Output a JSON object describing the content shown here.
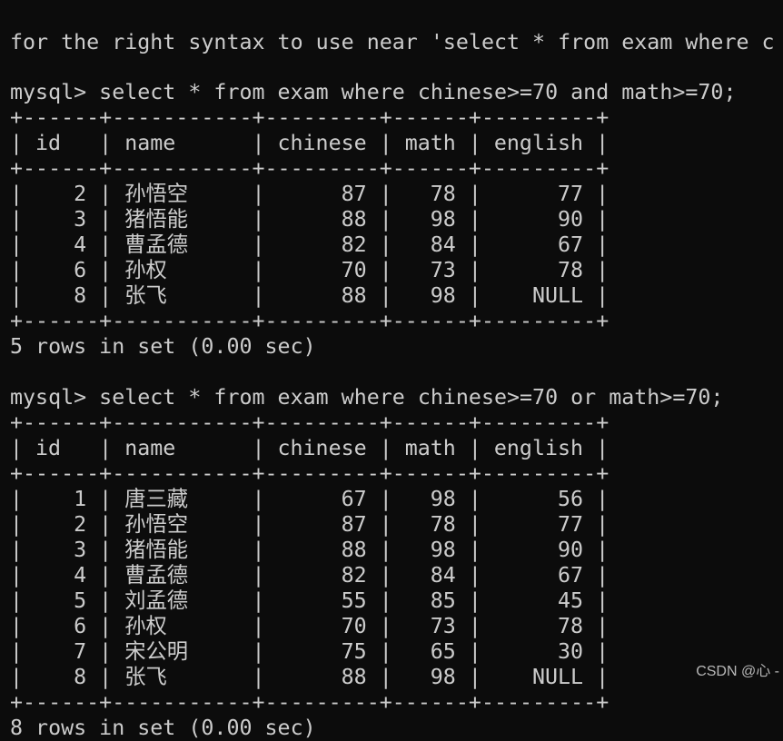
{
  "terminal": {
    "previous_output_partial": "for the right syntax to use near 'select * from exam where c",
    "queries": [
      {
        "command": "mysql> select * from exam where chinese>=70 and math>=70;",
        "columns": [
          "id",
          "name",
          "chinese",
          "math",
          "english"
        ],
        "rows": [
          [
            "2",
            "孙悟空",
            "87",
            "78",
            "77"
          ],
          [
            "3",
            "猪悟能",
            "88",
            "98",
            "90"
          ],
          [
            "4",
            "曹孟德",
            "82",
            "84",
            "67"
          ],
          [
            "6",
            "孙权",
            "70",
            "73",
            "78"
          ],
          [
            "8",
            "张飞",
            "88",
            "98",
            "NULL"
          ]
        ],
        "summary": "5 rows in set (0.00 sec)"
      },
      {
        "command": "mysql> select * from exam where chinese>=70 or math>=70;",
        "columns": [
          "id",
          "name",
          "chinese",
          "math",
          "english"
        ],
        "rows": [
          [
            "1",
            "唐三藏",
            "67",
            "98",
            "56"
          ],
          [
            "2",
            "孙悟空",
            "87",
            "78",
            "77"
          ],
          [
            "3",
            "猪悟能",
            "88",
            "98",
            "90"
          ],
          [
            "4",
            "曹孟德",
            "82",
            "84",
            "67"
          ],
          [
            "5",
            "刘孟德",
            "55",
            "85",
            "45"
          ],
          [
            "6",
            "孙权",
            "70",
            "73",
            "78"
          ],
          [
            "7",
            "宋公明",
            "75",
            "65",
            "30"
          ],
          [
            "8",
            "张飞",
            "88",
            "98",
            "NULL"
          ]
        ],
        "summary": "8 rows in set (0.00 sec)"
      }
    ]
  },
  "watermark": "CSDN @心 -",
  "colors": {
    "background": "#0c0c0c",
    "text": "#cccccc"
  }
}
